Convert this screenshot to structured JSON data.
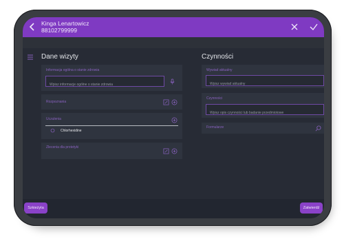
{
  "header": {
    "patient_name": "Kinga Lenartowicz",
    "patient_id": "88102799999"
  },
  "left": {
    "title": "Dane wizyty",
    "health": {
      "label": "Informacja ogólna o stanie zdrowia",
      "placeholder": "Wpisz informacje ogólne o stanie zdrowia"
    },
    "diagnoses": {
      "label": "Rozpoznania"
    },
    "allergies": {
      "label": "Uczulenia",
      "items": [
        "Chlorhexidine"
      ]
    },
    "orthodontic": {
      "label": "Zlecenia dla protetyki"
    }
  },
  "right": {
    "title": "Czynności",
    "current_interview": {
      "label": "Wywiad aktualny",
      "placeholder": "Wpisz wywiad aktualny"
    },
    "activities": {
      "label": "Czynności",
      "placeholder": "Wpisz opis czynności lub badanie przedmiotowe"
    },
    "forms": {
      "label": "Formularze"
    }
  },
  "footer": {
    "left_button": "Szkieżyta",
    "right_button": "Zatwierdź"
  },
  "colors": {
    "accent": "#7f3ac2",
    "background": "#272b35",
    "card": "#2f343f"
  },
  "icons": {
    "back": "chevron-left-icon",
    "close": "close-icon",
    "confirm": "check-icon",
    "menu": "hamburger-icon",
    "mic": "microphone-icon",
    "add": "plus-circle-icon",
    "edit": "edit-icon",
    "search": "search-icon"
  }
}
